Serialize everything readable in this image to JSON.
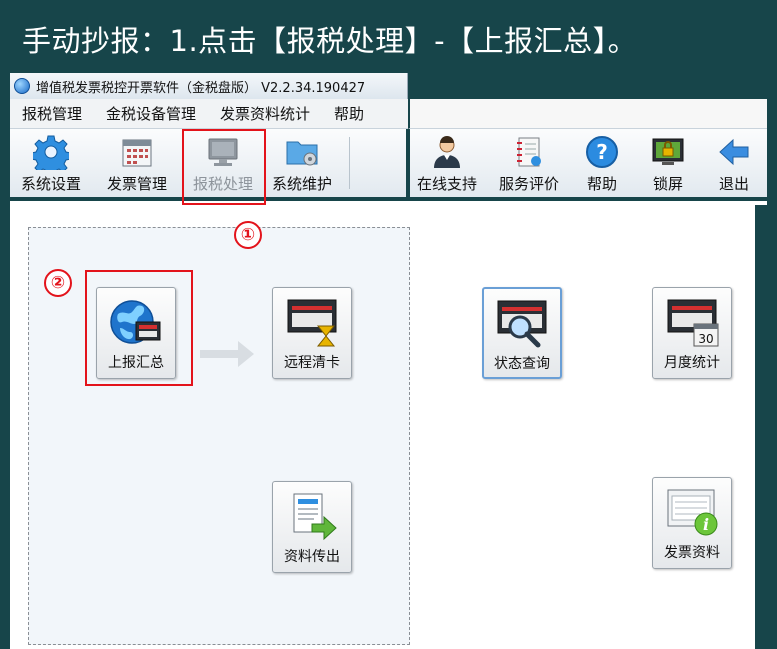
{
  "banner": {
    "text": "手动抄报：1.点击【报税处理】-【上报汇总】。"
  },
  "window": {
    "title": "增值税发票税控开票软件（金税盘版） V2.2.34.190427"
  },
  "menu": {
    "items": [
      "报税管理",
      "金税设备管理",
      "发票资料统计",
      "帮助"
    ]
  },
  "toolbar": {
    "system_settings": "系统设置",
    "invoice_mgmt": "发票管理",
    "tax_processing": "报税处理",
    "system_maintenance": "系统维护",
    "online_support": "在线支持",
    "service_rating": "服务评价",
    "help": "帮助",
    "lock_screen": "锁屏",
    "exit": "退出"
  },
  "callouts": {
    "step1": "①",
    "step2": "②"
  },
  "functions": {
    "upload_summary": "上报汇总",
    "remote_clear": "远程清卡",
    "status_query": "状态查询",
    "monthly_stats": "月度统计",
    "data_export": "资料传出",
    "invoice_data": "发票资料"
  },
  "icons": {
    "monthly_stats_day": "30"
  },
  "colors": {
    "background": "#17454a",
    "highlight": "#e3131b",
    "accent_blue": "#1769c7"
  }
}
